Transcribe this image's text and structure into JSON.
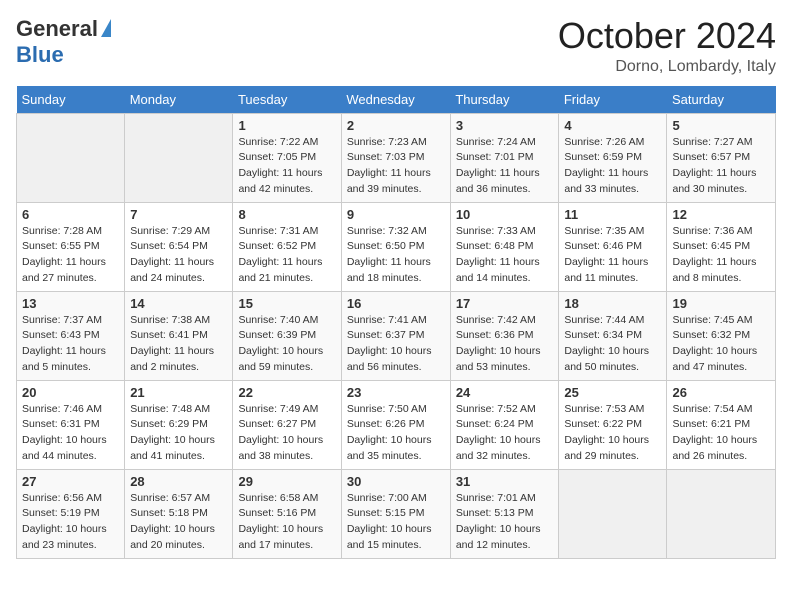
{
  "logo": {
    "general": "General",
    "blue": "Blue"
  },
  "title": "October 2024",
  "location": "Dorno, Lombardy, Italy",
  "days_header": [
    "Sunday",
    "Monday",
    "Tuesday",
    "Wednesday",
    "Thursday",
    "Friday",
    "Saturday"
  ],
  "weeks": [
    [
      {
        "day": "",
        "info": ""
      },
      {
        "day": "",
        "info": ""
      },
      {
        "day": "1",
        "info": "Sunrise: 7:22 AM\nSunset: 7:05 PM\nDaylight: 11 hours and 42 minutes."
      },
      {
        "day": "2",
        "info": "Sunrise: 7:23 AM\nSunset: 7:03 PM\nDaylight: 11 hours and 39 minutes."
      },
      {
        "day": "3",
        "info": "Sunrise: 7:24 AM\nSunset: 7:01 PM\nDaylight: 11 hours and 36 minutes."
      },
      {
        "day": "4",
        "info": "Sunrise: 7:26 AM\nSunset: 6:59 PM\nDaylight: 11 hours and 33 minutes."
      },
      {
        "day": "5",
        "info": "Sunrise: 7:27 AM\nSunset: 6:57 PM\nDaylight: 11 hours and 30 minutes."
      }
    ],
    [
      {
        "day": "6",
        "info": "Sunrise: 7:28 AM\nSunset: 6:55 PM\nDaylight: 11 hours and 27 minutes."
      },
      {
        "day": "7",
        "info": "Sunrise: 7:29 AM\nSunset: 6:54 PM\nDaylight: 11 hours and 24 minutes."
      },
      {
        "day": "8",
        "info": "Sunrise: 7:31 AM\nSunset: 6:52 PM\nDaylight: 11 hours and 21 minutes."
      },
      {
        "day": "9",
        "info": "Sunrise: 7:32 AM\nSunset: 6:50 PM\nDaylight: 11 hours and 18 minutes."
      },
      {
        "day": "10",
        "info": "Sunrise: 7:33 AM\nSunset: 6:48 PM\nDaylight: 11 hours and 14 minutes."
      },
      {
        "day": "11",
        "info": "Sunrise: 7:35 AM\nSunset: 6:46 PM\nDaylight: 11 hours and 11 minutes."
      },
      {
        "day": "12",
        "info": "Sunrise: 7:36 AM\nSunset: 6:45 PM\nDaylight: 11 hours and 8 minutes."
      }
    ],
    [
      {
        "day": "13",
        "info": "Sunrise: 7:37 AM\nSunset: 6:43 PM\nDaylight: 11 hours and 5 minutes."
      },
      {
        "day": "14",
        "info": "Sunrise: 7:38 AM\nSunset: 6:41 PM\nDaylight: 11 hours and 2 minutes."
      },
      {
        "day": "15",
        "info": "Sunrise: 7:40 AM\nSunset: 6:39 PM\nDaylight: 10 hours and 59 minutes."
      },
      {
        "day": "16",
        "info": "Sunrise: 7:41 AM\nSunset: 6:37 PM\nDaylight: 10 hours and 56 minutes."
      },
      {
        "day": "17",
        "info": "Sunrise: 7:42 AM\nSunset: 6:36 PM\nDaylight: 10 hours and 53 minutes."
      },
      {
        "day": "18",
        "info": "Sunrise: 7:44 AM\nSunset: 6:34 PM\nDaylight: 10 hours and 50 minutes."
      },
      {
        "day": "19",
        "info": "Sunrise: 7:45 AM\nSunset: 6:32 PM\nDaylight: 10 hours and 47 minutes."
      }
    ],
    [
      {
        "day": "20",
        "info": "Sunrise: 7:46 AM\nSunset: 6:31 PM\nDaylight: 10 hours and 44 minutes."
      },
      {
        "day": "21",
        "info": "Sunrise: 7:48 AM\nSunset: 6:29 PM\nDaylight: 10 hours and 41 minutes."
      },
      {
        "day": "22",
        "info": "Sunrise: 7:49 AM\nSunset: 6:27 PM\nDaylight: 10 hours and 38 minutes."
      },
      {
        "day": "23",
        "info": "Sunrise: 7:50 AM\nSunset: 6:26 PM\nDaylight: 10 hours and 35 minutes."
      },
      {
        "day": "24",
        "info": "Sunrise: 7:52 AM\nSunset: 6:24 PM\nDaylight: 10 hours and 32 minutes."
      },
      {
        "day": "25",
        "info": "Sunrise: 7:53 AM\nSunset: 6:22 PM\nDaylight: 10 hours and 29 minutes."
      },
      {
        "day": "26",
        "info": "Sunrise: 7:54 AM\nSunset: 6:21 PM\nDaylight: 10 hours and 26 minutes."
      }
    ],
    [
      {
        "day": "27",
        "info": "Sunrise: 6:56 AM\nSunset: 5:19 PM\nDaylight: 10 hours and 23 minutes."
      },
      {
        "day": "28",
        "info": "Sunrise: 6:57 AM\nSunset: 5:18 PM\nDaylight: 10 hours and 20 minutes."
      },
      {
        "day": "29",
        "info": "Sunrise: 6:58 AM\nSunset: 5:16 PM\nDaylight: 10 hours and 17 minutes."
      },
      {
        "day": "30",
        "info": "Sunrise: 7:00 AM\nSunset: 5:15 PM\nDaylight: 10 hours and 15 minutes."
      },
      {
        "day": "31",
        "info": "Sunrise: 7:01 AM\nSunset: 5:13 PM\nDaylight: 10 hours and 12 minutes."
      },
      {
        "day": "",
        "info": ""
      },
      {
        "day": "",
        "info": ""
      }
    ]
  ]
}
